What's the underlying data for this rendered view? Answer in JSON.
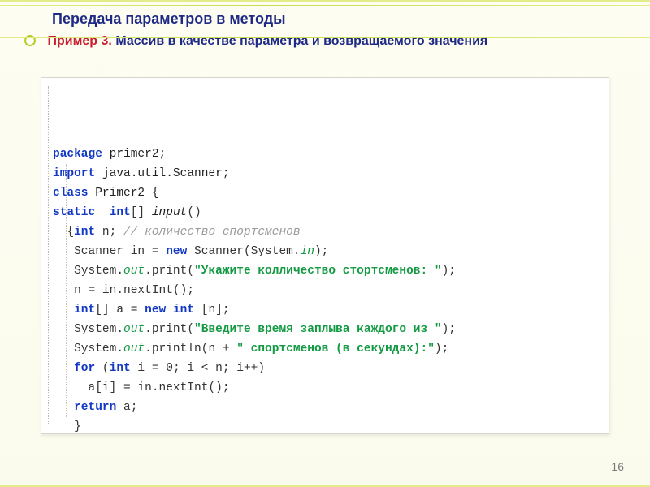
{
  "title": "Передача параметров в методы",
  "example_label": "Пример 3.",
  "example_text": "Массив в качестве параметра и возвращаемого значения",
  "page_number": "16",
  "code": {
    "l1a": "package",
    "l1b": " primer2;",
    "l2a": "import",
    "l2b": " java.util.Scanner;",
    "l3a": "class",
    "l3b": " Primer2 {",
    "l4a": "static",
    "l4b": "  int",
    "l4c": "[] ",
    "l4d": "input",
    "l4e": "()",
    "l5a": "  {",
    "l5b": "int",
    "l5c": " n; ",
    "l5d": "// количество спортсменов",
    "l6a": "   Scanner in = ",
    "l6b": "new",
    "l6c": " Scanner(System.",
    "l6d": "in",
    "l6e": ");",
    "l7a": "   System.",
    "l7b": "out",
    "l7c": ".print(",
    "l7d": "\"Укажите колличество стортсменов: \"",
    "l7e": ");",
    "l8a": "   n = in.nextInt();",
    "l9a": "   ",
    "l9b": "int",
    "l9c": "[] a = ",
    "l9d": "new",
    "l9e": " int",
    "l9f": " [n];",
    "l10a": "   System.",
    "l10b": "out",
    "l10c": ".print(",
    "l10d": "\"Введите время заплыва каждого из \"",
    "l10e": ");",
    "l11a": "   System.",
    "l11b": "out",
    "l11c": ".println(n + ",
    "l11d": "\" спортсменов (в секундах):\"",
    "l11e": ");",
    "l12a": "   ",
    "l12b": "for",
    "l12c": " (",
    "l12d": "int",
    "l12e": " i = 0; i < n; i++)",
    "l13a": "     a[i] = in.nextInt();",
    "l14a": "   ",
    "l14b": "return",
    "l14c": " a;",
    "l15a": "   }"
  }
}
